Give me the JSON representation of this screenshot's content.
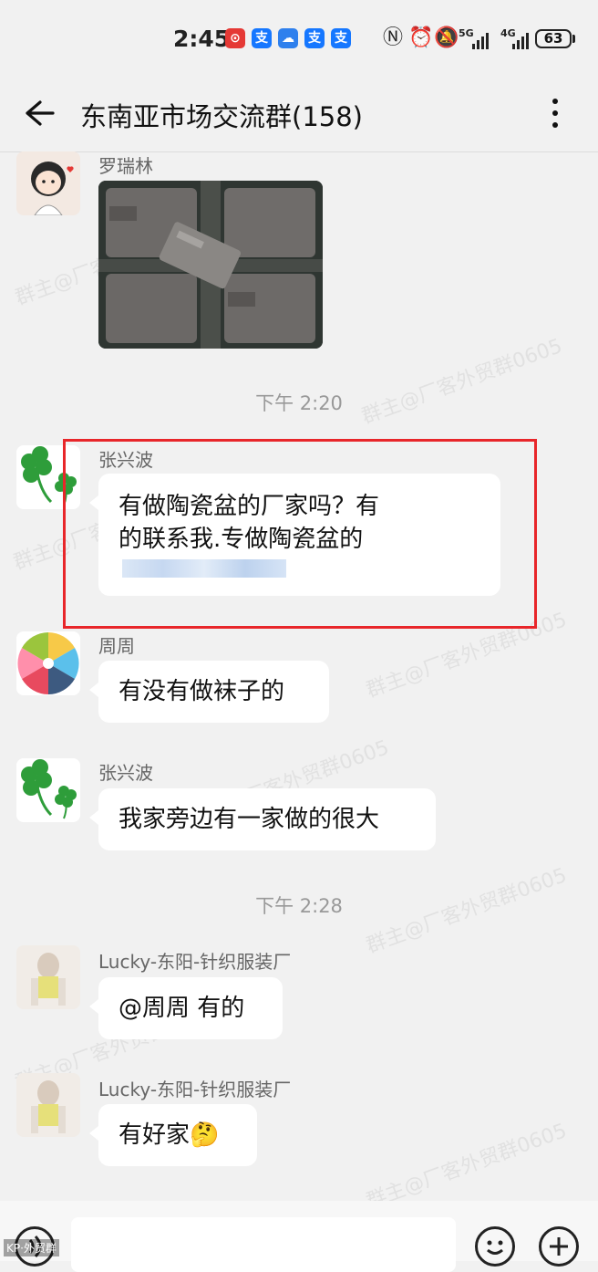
{
  "status_bar": {
    "time": "2:45",
    "network_1": "5G",
    "network_2": "4G",
    "battery": "63",
    "app_icons": [
      "red-app-icon",
      "alipay-icon",
      "cloud-icon",
      "alipay-icon",
      "alipay-icon"
    ],
    "system_icons": [
      "nfc-icon",
      "alarm-icon",
      "mute-icon"
    ]
  },
  "header": {
    "title": "东南亚市场交流群(158)",
    "back_icon": "arrow-left-icon",
    "more_icon": "more-vertical-icon"
  },
  "messages": [
    {
      "sender": "罗瑞林",
      "type": "image",
      "avatar": "cartoon-girl-avatar"
    },
    {
      "time": "下午 2:20"
    },
    {
      "sender": "张兴波",
      "type": "text",
      "lines": [
        "有做陶瓷盆的厂家吗？有",
        "的联系我.专做陶瓷盆的"
      ],
      "avatar": "clover-avatar"
    },
    {
      "sender": "周周",
      "type": "text",
      "text": "有没有做袜子的",
      "avatar": "color-fan-avatar"
    },
    {
      "sender": "张兴波",
      "type": "text",
      "text": "我家旁边有一家做的很大",
      "avatar": "clover-avatar"
    },
    {
      "time": "下午 2:28"
    },
    {
      "sender": "Lucky-东阳-针织服装厂",
      "type": "text",
      "text": "@周周 有的",
      "avatar": "blurred-avatar"
    },
    {
      "sender": "Lucky-东阳-针织服装厂",
      "type": "text",
      "text": "有好家",
      "emoji": "🤔",
      "avatar": "blurred-avatar"
    }
  ],
  "watermark": "群主@厂客外贸群0605",
  "input_bar": {
    "voice_icon": "voice-icon",
    "emoji_icon": "smiley-icon",
    "add_icon": "plus-icon",
    "corner_tag": "KP·外贸群"
  },
  "colors": {
    "highlight": "#e8262a",
    "background": "#f1f1f1",
    "bubble": "#ffffff"
  }
}
